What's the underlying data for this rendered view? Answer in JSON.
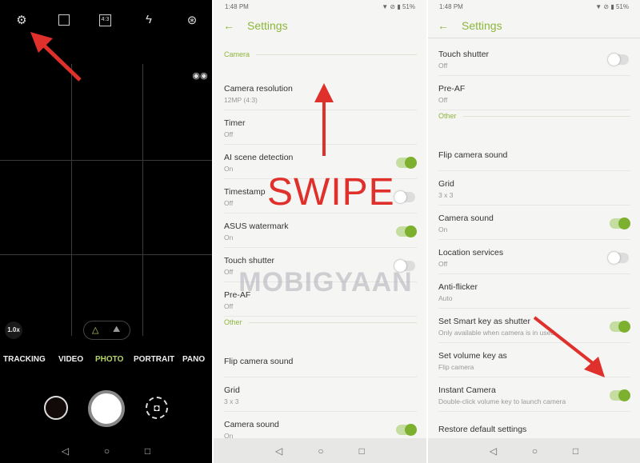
{
  "camera": {
    "top_icons": [
      "settings-icon",
      "hdr-icon",
      "aspect-ratio-icon",
      "flash-off-icon",
      "filter-icon"
    ],
    "aspect_label": "4:3",
    "zoom": "1.0x",
    "modes": [
      "TRACKING",
      "VIDEO",
      "PHOTO",
      "PORTRAIT",
      "PANO"
    ],
    "active_mode": "PHOTO"
  },
  "status": {
    "time": "1:48",
    "ampm": "PM",
    "battery": "51%"
  },
  "settings": {
    "title": "Settings"
  },
  "panel2": {
    "items": [
      {
        "type": "section",
        "title": "Camera"
      },
      {
        "title": "Camera resolution",
        "sub": "12MP (4:3)"
      },
      {
        "title": "Timer",
        "sub": "Off"
      },
      {
        "title": "AI scene detection",
        "sub": "On",
        "toggle": "on"
      },
      {
        "title": "Timestamp",
        "sub": "Off",
        "toggle": "off"
      },
      {
        "title": "ASUS watermark",
        "sub": "On",
        "toggle": "on"
      },
      {
        "title": "Touch shutter",
        "sub": "Off",
        "toggle": "off"
      },
      {
        "title": "Pre-AF",
        "sub": "Off"
      },
      {
        "type": "section",
        "title": "Other"
      },
      {
        "title": "Flip camera sound"
      },
      {
        "title": "Grid",
        "sub": "3 x 3"
      },
      {
        "title": "Camera sound",
        "sub": "On",
        "toggle": "on"
      }
    ]
  },
  "panel3": {
    "items": [
      {
        "title": "Touch shutter",
        "sub": "Off",
        "toggle": "off"
      },
      {
        "title": "Pre-AF",
        "sub": "Off"
      },
      {
        "type": "section",
        "title": "Other"
      },
      {
        "title": "Flip camera sound"
      },
      {
        "title": "Grid",
        "sub": "3 x 3"
      },
      {
        "title": "Camera sound",
        "sub": "On",
        "toggle": "on"
      },
      {
        "title": "Location services",
        "sub": "Off",
        "toggle": "off"
      },
      {
        "title": "Anti-flicker",
        "sub": "Auto"
      },
      {
        "title": "Set Smart key as shutter",
        "sub": "Only available when camera is in used",
        "toggle": "on"
      },
      {
        "title": "Set volume key as",
        "sub": "Flip camera"
      },
      {
        "title": "Instant Camera",
        "sub": "Double-click volume key to launch camera",
        "toggle": "on"
      },
      {
        "title": "Restore default settings"
      }
    ]
  },
  "overlay": {
    "swipe": "SWIPE",
    "watermark": "MOBIGYAAN"
  },
  "colors": {
    "accent": "#8db63c",
    "toggle_on": "#7db02e",
    "arrow": "#e0302c"
  }
}
